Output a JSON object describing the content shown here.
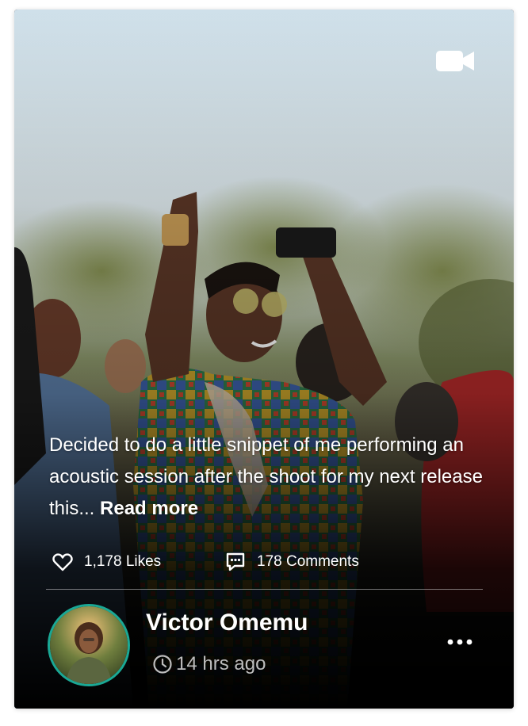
{
  "post": {
    "caption": "Decided to do a little snippet of me performing an acoustic session after the shoot for my next release this...",
    "read_more": "Read more",
    "likes": "1,178 Likes",
    "comments": "178 Comments"
  },
  "author": {
    "name": "Victor Omemu",
    "time_ago": "14 hrs ago"
  },
  "icons": {
    "video": "video-camera-icon",
    "like": "heart-icon",
    "comment": "comment-icon",
    "clock": "clock-icon",
    "more": "more-horizontal-icon"
  },
  "colors": {
    "avatar_ring": "#1aa895",
    "text": "#ffffff",
    "muted": "#bdbdbd"
  }
}
